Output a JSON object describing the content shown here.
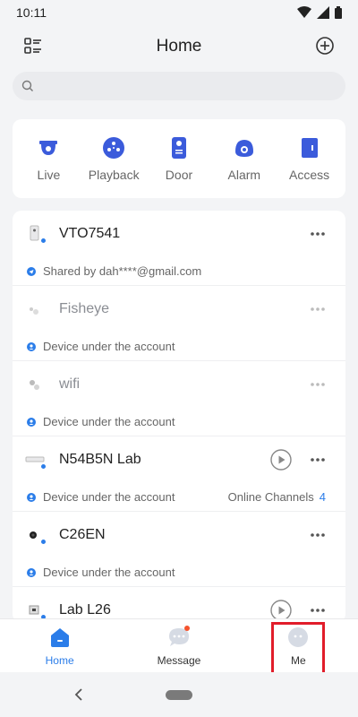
{
  "status": {
    "time": "10:11"
  },
  "header": {
    "title": "Home"
  },
  "search": {
    "placeholder": ""
  },
  "quick_actions": [
    {
      "label": "Live",
      "icon": "camera-dome-icon"
    },
    {
      "label": "Playback",
      "icon": "playback-icon"
    },
    {
      "label": "Door",
      "icon": "door-station-icon"
    },
    {
      "label": "Alarm",
      "icon": "alarm-icon"
    },
    {
      "label": "Access",
      "icon": "access-icon"
    }
  ],
  "devices": [
    {
      "name": "VTO7541",
      "sub": "Shared by dah****@gmail.com",
      "sub_icon": "share-icon",
      "dim": false,
      "play": false
    },
    {
      "name": "Fisheye",
      "sub": "Device under the account",
      "sub_icon": "account-icon",
      "dim": true,
      "play": false
    },
    {
      "name": "wifi",
      "sub": "Device under the account",
      "sub_icon": "account-icon",
      "dim": true,
      "play": false
    },
    {
      "name": "N54B5N Lab",
      "sub": "Device under the account",
      "sub_icon": "account-icon",
      "dim": false,
      "play": true,
      "online_label": "Online Channels",
      "online_count": "4"
    },
    {
      "name": "C26EN",
      "sub": "Device under the account",
      "sub_icon": "account-icon",
      "dim": false,
      "play": false
    },
    {
      "name": "Lab L26",
      "sub": "",
      "dim": false,
      "play": true
    }
  ],
  "bottom_nav": [
    {
      "label": "Home",
      "icon": "home-icon",
      "active": true
    },
    {
      "label": "Message",
      "icon": "message-icon",
      "active": false
    },
    {
      "label": "Me",
      "icon": "profile-icon",
      "active": false
    }
  ],
  "colors": {
    "accent": "#2b7de9",
    "highlight": "#e11d2a",
    "quick_icon": "#3b5bdb"
  }
}
